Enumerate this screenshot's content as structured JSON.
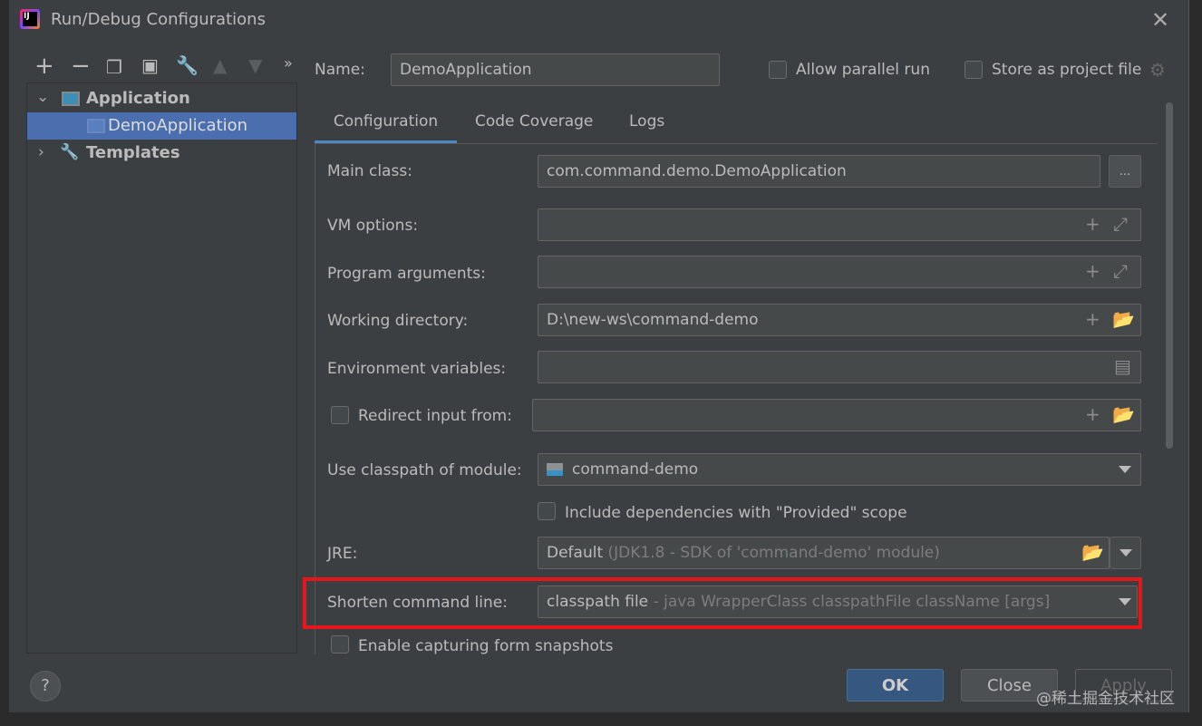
{
  "window": {
    "title": "Run/Debug Configurations",
    "logo_text": "IJ"
  },
  "toolbar": {
    "icons": [
      "plus-icon",
      "minus-icon",
      "copy-icon",
      "save-icon",
      "wrench-icon",
      "arrow-up-icon",
      "arrow-down-icon",
      "more-icon"
    ],
    "more": "»"
  },
  "tree": {
    "items": [
      {
        "label": "Application",
        "expanded": true
      },
      {
        "label": "DemoApplication",
        "selected": true
      },
      {
        "label": "Templates",
        "expanded": false
      }
    ]
  },
  "header": {
    "name_label": "Name:",
    "name_value": "DemoApplication",
    "allow_parallel": "Allow parallel run",
    "store_project": "Store as project file"
  },
  "tabs": [
    {
      "label": "Configuration",
      "active": true
    },
    {
      "label": "Code Coverage"
    },
    {
      "label": "Logs"
    }
  ],
  "form": {
    "main_class_label": "Main class:",
    "main_class_value": "com.command.demo.DemoApplication",
    "browse": "...",
    "vm_label": "VM options:",
    "vm_value": "",
    "args_label": "Program arguments:",
    "args_value": "",
    "wd_label": "Working directory:",
    "wd_value": "D:\\new-ws\\command-demo",
    "env_label": "Environment variables:",
    "env_value": "",
    "redirect_label": "Redirect input from:",
    "redirect_value": "",
    "module_label": "Use classpath of module:",
    "module_value": "command-demo",
    "include_deps": "Include dependencies with \"Provided\" scope",
    "jre_label": "JRE:",
    "jre_value": "Default",
    "jre_hint": "(JDK1.8 - SDK of 'command-demo' module)",
    "shorten_label": "Shorten command line:",
    "shorten_value": "classpath file",
    "shorten_hint": "- java WrapperClass classpathFile className [args]",
    "capture": "Enable capturing form snapshots"
  },
  "buttons": {
    "help": "?",
    "ok": "OK",
    "close": "Close",
    "apply": "Apply"
  },
  "highlight_color": "#e8161b",
  "watermark": "@稀土掘金技术社区"
}
